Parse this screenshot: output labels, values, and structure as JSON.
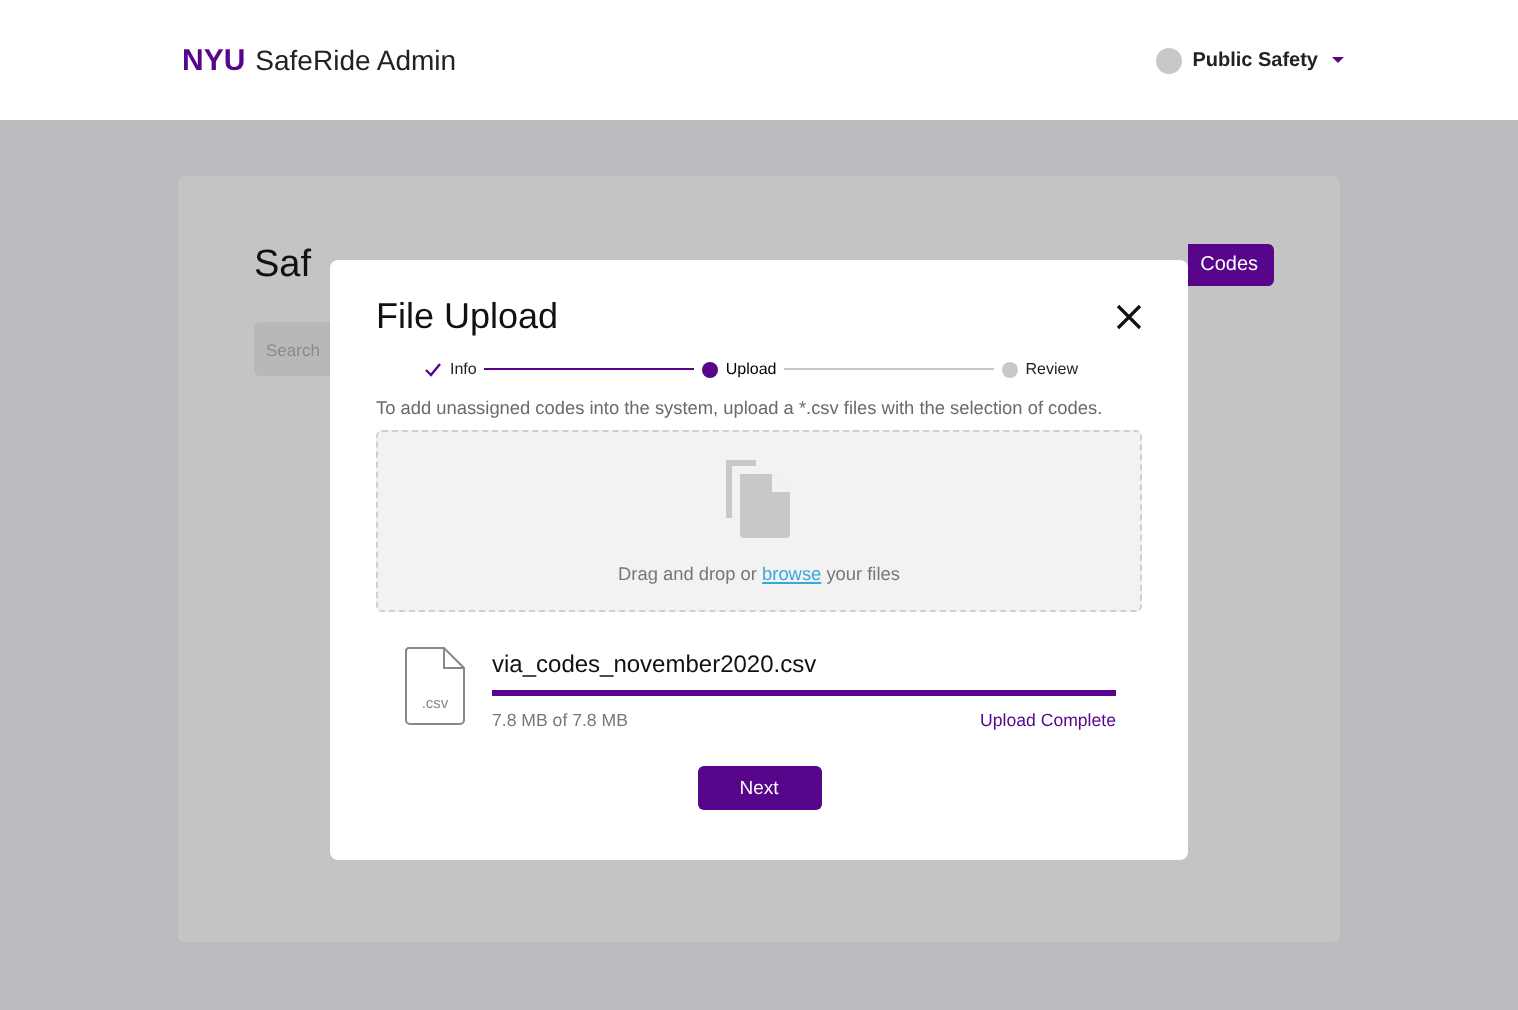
{
  "header": {
    "brand": "NYU",
    "app_name": "SafeRide Admin",
    "user": "Public Safety"
  },
  "background": {
    "title": "Saf",
    "search_placeholder": "Search",
    "button": "Codes"
  },
  "modal": {
    "title": "File Upload",
    "steps": [
      {
        "label": "Info",
        "completed": true,
        "current": false
      },
      {
        "label": "Upload",
        "completed": false,
        "current": true
      },
      {
        "label": "Review",
        "completed": false,
        "current": false
      }
    ],
    "instructions": "To add unassigned codes into the system, upload a *.csv files with the selection of codes.",
    "dropzone": {
      "text_before": "Drag and drop or ",
      "link": "browse",
      "text_after": " your files"
    },
    "file": {
      "name": "via_codes_november2020.csv",
      "extension": ".csv",
      "level": 1,
      "size": "7.8 MB of 7.8 MB",
      "status": "Upload Complete"
    },
    "next_button": "Next"
  }
}
